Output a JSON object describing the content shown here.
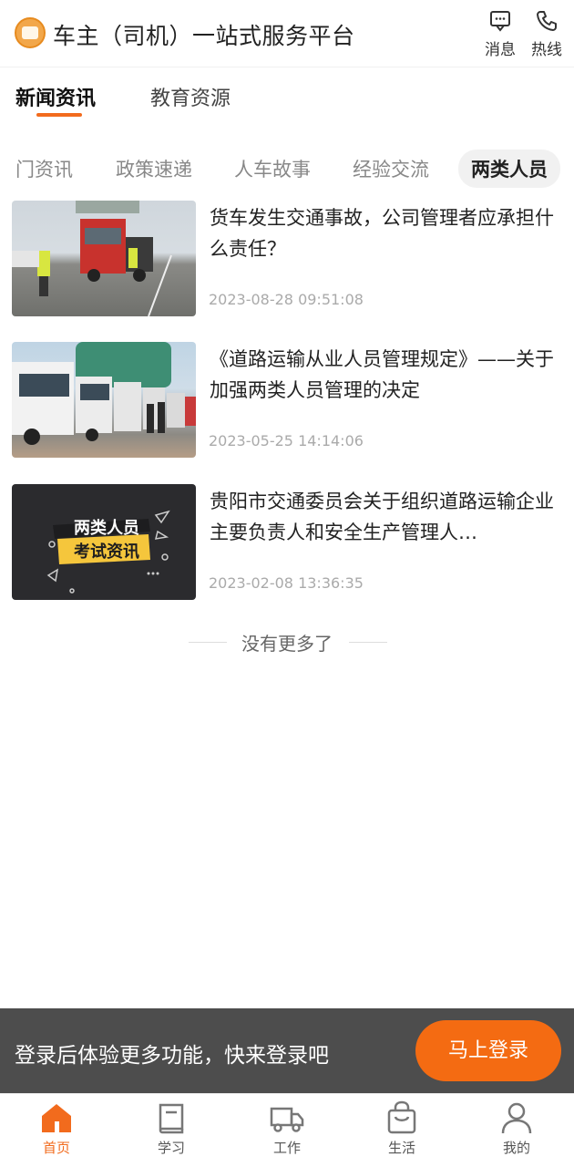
{
  "header": {
    "title": "车主（司机）一站式服务平台",
    "actions": [
      {
        "label": "消息",
        "icon": "message-icon"
      },
      {
        "label": "热线",
        "icon": "phone-icon"
      }
    ]
  },
  "main_tabs": [
    {
      "label": "新闻资讯",
      "active": true
    },
    {
      "label": "教育资源",
      "active": false
    }
  ],
  "category_tabs": [
    {
      "label": "门资讯",
      "active": false
    },
    {
      "label": "政策速递",
      "active": false
    },
    {
      "label": "人车故事",
      "active": false
    },
    {
      "label": "经验交流",
      "active": false
    },
    {
      "label": "两类人员",
      "active": true
    }
  ],
  "articles": [
    {
      "title": "货车发生交通事故，公司管理者应承担什么责任？",
      "date": "2023-08-28 09:51:08",
      "thumb": "truck-accident-photo"
    },
    {
      "title": "《道路运输从业人员管理规定》——关于加强两类人员管理的决定",
      "date": "2023-05-25 14:14:06",
      "thumb": "truck-fleet-photo"
    },
    {
      "title": "贵阳市交通委员会关于组织道路运输企业主要负责人和安全生产管理人…",
      "date": "2023-02-08 13:36:35",
      "thumb": "exam-news-graphic",
      "thumb_text": [
        "两类人员",
        "考试资讯"
      ]
    }
  ],
  "list_end": "没有更多了",
  "login_banner": {
    "text": "登录后体验更多功能，快来登录吧",
    "button": "马上登录"
  },
  "bottom_nav": [
    {
      "label": "首页",
      "icon": "home-icon",
      "active": true
    },
    {
      "label": "学习",
      "icon": "book-icon",
      "active": false
    },
    {
      "label": "工作",
      "icon": "truck-icon",
      "active": false
    },
    {
      "label": "生活",
      "icon": "bag-icon",
      "active": false
    },
    {
      "label": "我的",
      "icon": "user-icon",
      "active": false
    }
  ],
  "colors": {
    "accent": "#f26b1d",
    "banner_bg": "#4d4d4d"
  }
}
